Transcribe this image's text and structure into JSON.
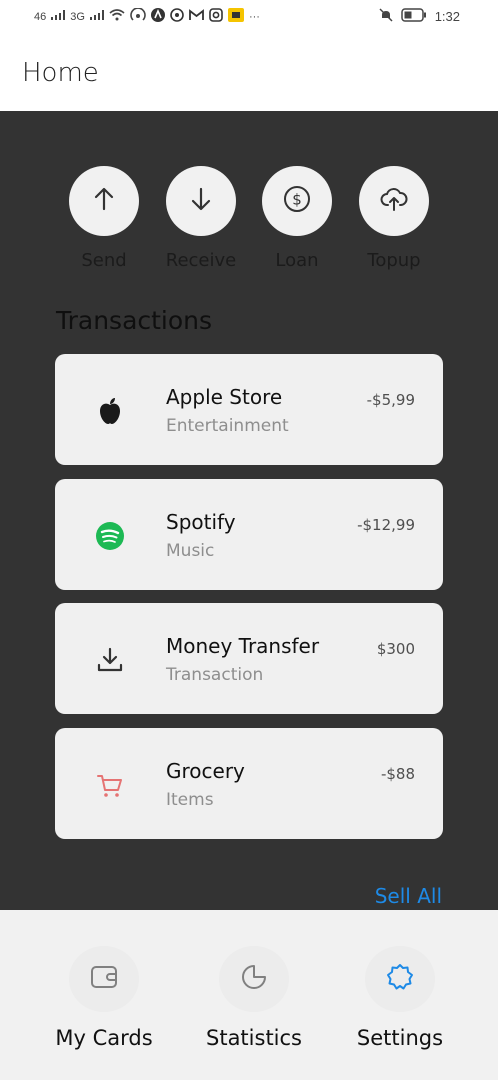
{
  "status_bar": {
    "network_left": "46",
    "network_right": "3G",
    "time": "1:32",
    "more": "···",
    "icons": [
      "signal-icon",
      "signal-icon",
      "wifi-icon",
      "hotspot-icon",
      "app-icon",
      "whatsapp-icon",
      "gmail-icon",
      "instagram-icon",
      "app-icon",
      "mute-icon",
      "battery-icon"
    ]
  },
  "header": {
    "title": "Home"
  },
  "actions": [
    {
      "label": "Send",
      "icon": "arrow-up-icon"
    },
    {
      "label": "Receive",
      "icon": "arrow-down-icon"
    },
    {
      "label": "Loan",
      "icon": "dollar-circle-icon"
    },
    {
      "label": "Topup",
      "icon": "cloud-upload-icon"
    }
  ],
  "transactions": {
    "title": "Transactions",
    "items": [
      {
        "name": "Apple Store",
        "category": "Entertainment",
        "amount": "-$5,99",
        "icon": "apple-icon"
      },
      {
        "name": "Spotify",
        "category": "Music",
        "amount": "-$12,99",
        "icon": "spotify-icon"
      },
      {
        "name": "Money Transfer",
        "category": "Transaction",
        "amount": "$300",
        "icon": "download-icon"
      },
      {
        "name": "Grocery",
        "category": "Items",
        "amount": "-$88",
        "icon": "cart-icon"
      }
    ],
    "see_all": "Sell All"
  },
  "nav": [
    {
      "label": "My Cards",
      "icon": "wallet-icon"
    },
    {
      "label": "Statistics",
      "icon": "pie-chart-icon"
    },
    {
      "label": "Settings",
      "icon": "gear-icon"
    }
  ],
  "colors": {
    "accent": "#1e8ae6",
    "background": "#333333",
    "card": "#f0f0f0",
    "spotify": "#1db954",
    "cart": "#e57373"
  }
}
